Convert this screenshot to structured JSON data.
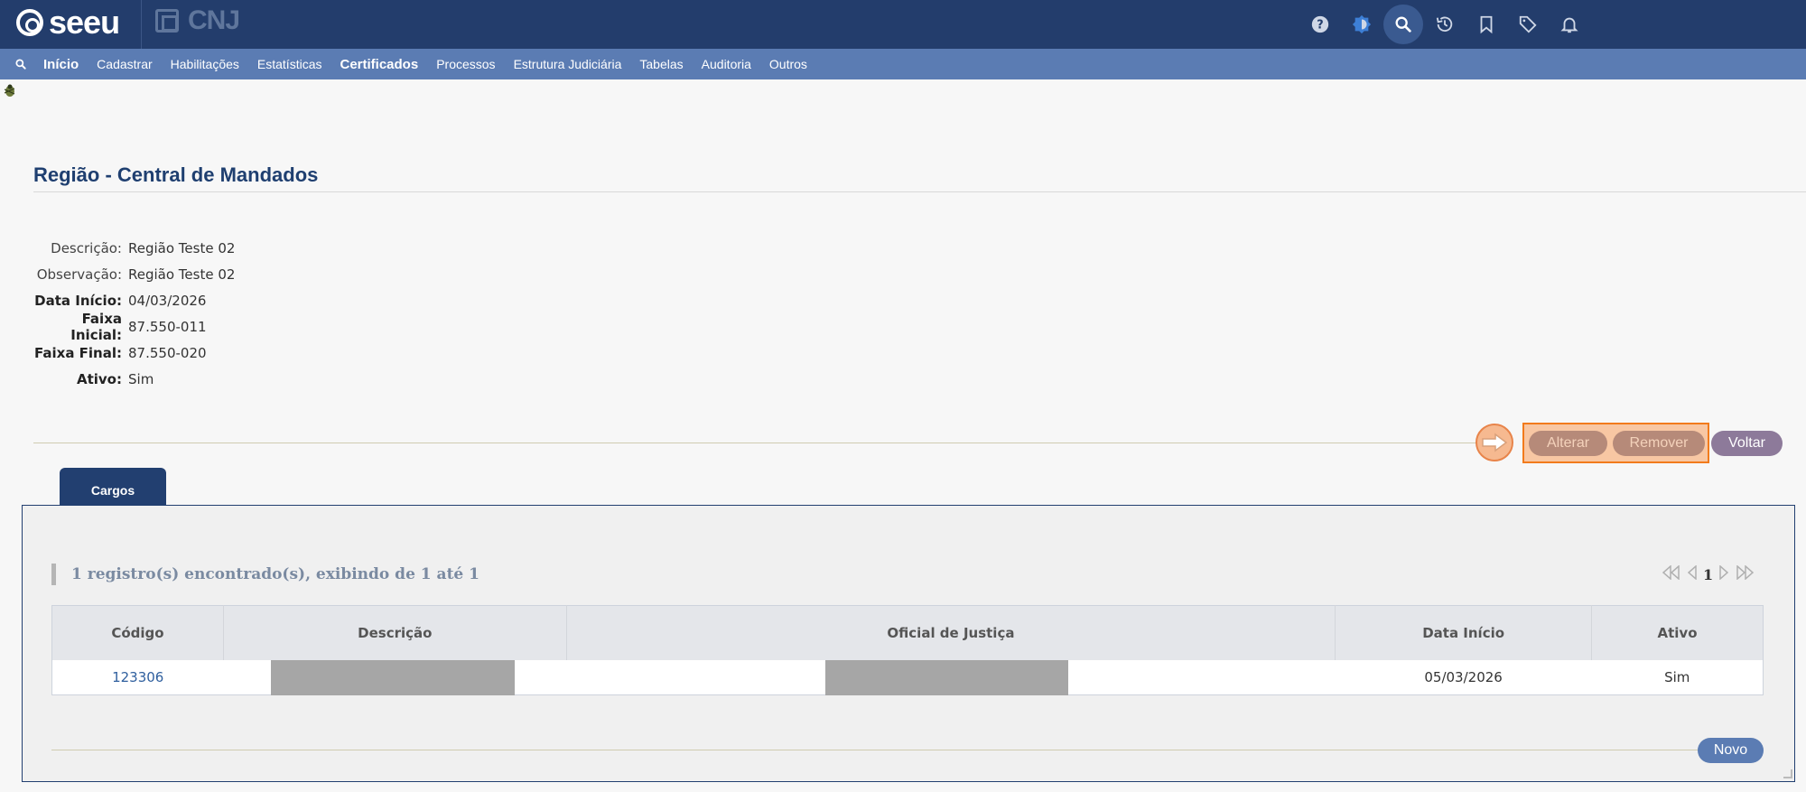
{
  "app": {
    "logo_text": "seeu",
    "partner_logo_text": "CNJ"
  },
  "toolbar_icons": [
    "help-icon",
    "theme-icon",
    "search-icon",
    "history-icon",
    "bookmark-icon",
    "tag-icon",
    "bell-icon"
  ],
  "menu": {
    "items": [
      "Início",
      "Cadastrar",
      "Habilitações",
      "Estatísticas",
      "Certificados",
      "Processos",
      "Estrutura Judiciária",
      "Tabelas",
      "Auditoria",
      "Outros"
    ]
  },
  "page": {
    "title": "Região - Central de Mandados"
  },
  "details": [
    {
      "label": "Descrição:",
      "value": "Região Teste 02"
    },
    {
      "label": "Observação:",
      "value": "Região Teste 02"
    },
    {
      "label": "Data Início:",
      "value": "04/03/2026"
    },
    {
      "label": "Faixa Inicial:",
      "value": "87.550-011"
    },
    {
      "label": "Faixa Final:",
      "value": "87.550-020"
    },
    {
      "label": "Ativo:",
      "value": "Sim"
    }
  ],
  "actions": {
    "alterar": "Alterar",
    "remover": "Remover",
    "voltar": "Voltar"
  },
  "tabs": [
    {
      "label": "Cargos"
    }
  ],
  "records": {
    "summary": "1 registro(s) encontrado(s), exibindo de 1 até 1",
    "current_page": "1"
  },
  "table": {
    "headers": [
      "Código",
      "Descrição",
      "Oficial de Justiça",
      "Data Início",
      "Ativo"
    ],
    "rows": [
      {
        "codigo": "123306",
        "descricao": "",
        "oficial": "",
        "data_inicio": "05/03/2026",
        "ativo": "Sim"
      }
    ]
  },
  "new_button": "Novo",
  "colors": {
    "topbar": "#233d6c",
    "menubar": "#5b7cb3",
    "highlight": "#f27b1c"
  }
}
